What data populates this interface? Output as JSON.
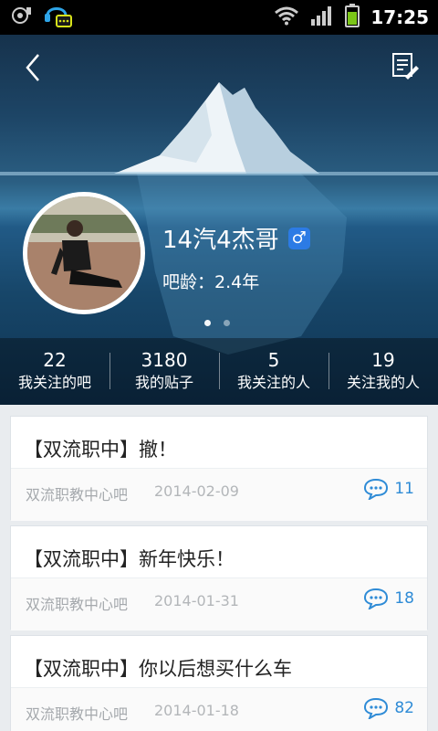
{
  "status_bar": {
    "time": "17:25"
  },
  "profile": {
    "username": "14汽4杰哥",
    "gender_symbol": "♂",
    "age_label": "吧龄：2.4年",
    "pager": {
      "pages": 2,
      "active": 1
    }
  },
  "stats": [
    {
      "value": "22",
      "label": "我关注的吧"
    },
    {
      "value": "3180",
      "label": "我的贴子"
    },
    {
      "value": "5",
      "label": "我关注的人"
    },
    {
      "value": "19",
      "label": "关注我的人"
    }
  ],
  "posts": [
    {
      "title": "【双流职中】撤！",
      "forum": "双流职教中心吧",
      "date": "2014-02-09",
      "replies": "11"
    },
    {
      "title": "【双流职中】新年快乐！",
      "forum": "双流职教中心吧",
      "date": "2014-01-31",
      "replies": "18"
    },
    {
      "title": "【双流职中】你以后想买什么车",
      "forum": "双流职教中心吧",
      "date": "2014-01-18",
      "replies": "82"
    }
  ],
  "colors": {
    "accent": "#2e8bd6",
    "header_bg": "#1d4566",
    "stat_bar": "#000000"
  },
  "icons": [
    "sd-card-icon",
    "chat-headset-icon",
    "wifi-icon",
    "signal-icon",
    "battery-icon",
    "back-arrow-icon",
    "edit-icon",
    "male-gender-icon",
    "comment-bubble-icon"
  ]
}
